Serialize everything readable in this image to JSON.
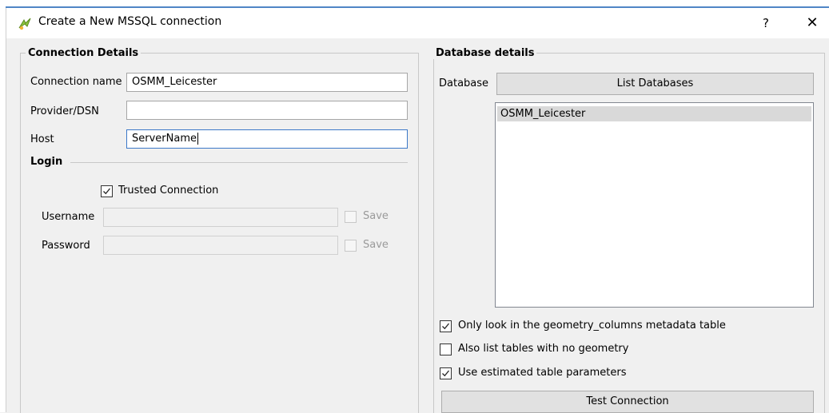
{
  "window": {
    "title": "Create a New MSSQL connection",
    "help_label": "?",
    "close_label": "✕"
  },
  "connection": {
    "section_title": "Connection Details",
    "name_label": "Connection name",
    "name_value": "OSMM_Leicester",
    "provider_label": "Provider/DSN",
    "provider_value": "",
    "host_label": "Host",
    "host_value": "ServerName"
  },
  "login": {
    "section_title": "Login",
    "trusted_label": "Trusted Connection",
    "trusted_checked": true,
    "username_label": "Username",
    "username_value": "",
    "password_label": "Password",
    "password_value": "",
    "save_label_1": "Save",
    "save_label_2": "Save"
  },
  "database": {
    "section_title": "Database details",
    "db_label": "Database",
    "list_button": "List Databases",
    "items": [
      "OSMM_Leicester"
    ],
    "opt_geometry_columns": "Only look in the geometry_columns metadata table",
    "opt_no_geometry": "Also list tables with no geometry",
    "opt_estimated": "Use estimated table parameters",
    "test_button": "Test Connection"
  },
  "options_state": {
    "geometry_columns": true,
    "no_geometry": false,
    "estimated": true
  },
  "colors": {
    "focus_border": "#3c78c8",
    "selection": "#d9d9d9",
    "window_bg": "#f0f0f0"
  }
}
